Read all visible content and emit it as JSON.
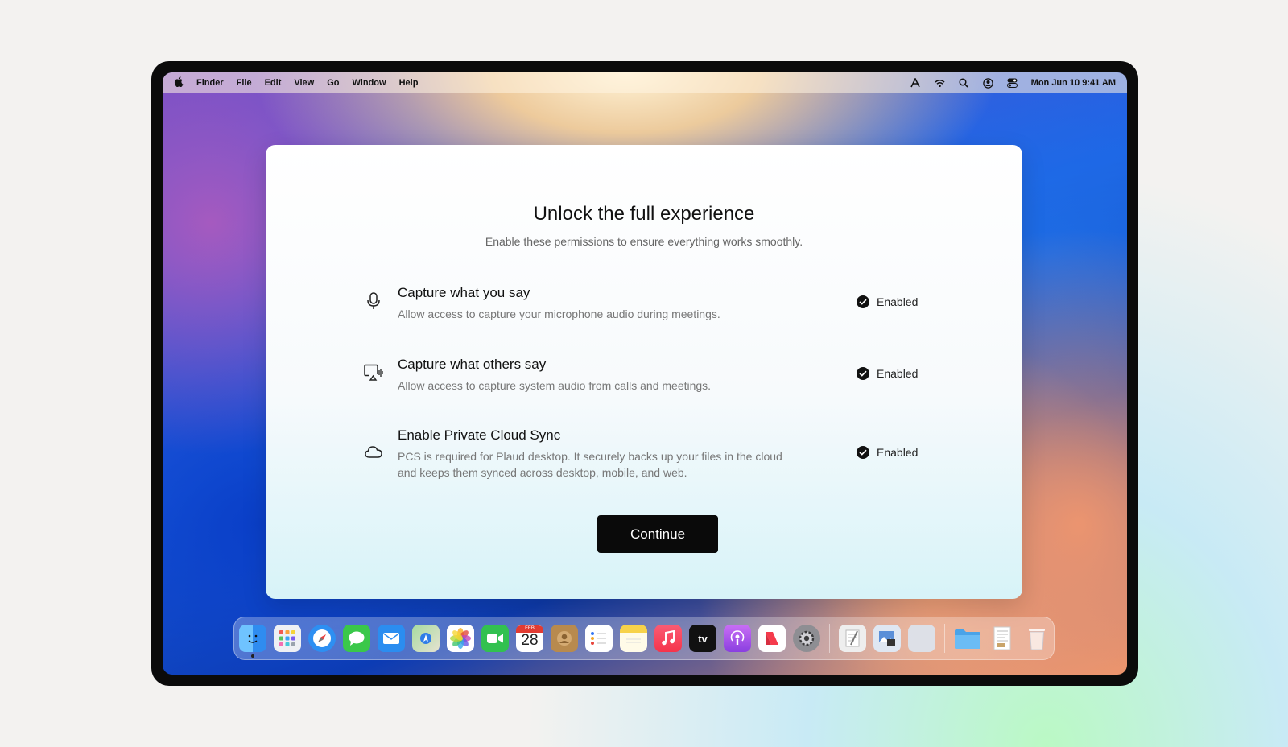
{
  "menubar": {
    "app_name": "Finder",
    "menus": [
      "File",
      "Edit",
      "View",
      "Go",
      "Window",
      "Help"
    ],
    "clock": "Mon Jun 10  9:41 AM"
  },
  "dialog": {
    "title": "Unlock the full experience",
    "subtitle": "Enable these permissions to ensure everything works smoothly.",
    "permissions": [
      {
        "icon": "microphone-icon",
        "title": "Capture what you say",
        "description": "Allow access to capture your microphone audio during meetings.",
        "status": "Enabled"
      },
      {
        "icon": "screen-audio-icon",
        "title": "Capture what others say",
        "description": "Allow access to capture system audio from calls and meetings.",
        "status": "Enabled"
      },
      {
        "icon": "cloud-icon",
        "title": "Enable Private Cloud Sync",
        "description": "PCS is required for Plaud desktop. It securely backs up your files in the cloud and keeps them synced across desktop, mobile, and web.",
        "status": "Enabled"
      }
    ],
    "continue_label": "Continue"
  },
  "dock": {
    "calendar_month": "FEB",
    "calendar_day": "28",
    "tv_label": "tv",
    "apps": [
      "Finder",
      "Launchpad",
      "Safari",
      "Messages",
      "Mail",
      "Maps",
      "Photos",
      "FaceTime",
      "Calendar",
      "Contacts",
      "Reminders",
      "Notes",
      "Music",
      "TV",
      "Podcasts",
      "News",
      "System Settings",
      "TextEdit",
      "Preview",
      "Blank",
      "Folder",
      "Document",
      "Trash"
    ]
  },
  "colors": {
    "accent": "#0a0a0a",
    "status_check": "#111111",
    "muted_text": "#777777"
  }
}
